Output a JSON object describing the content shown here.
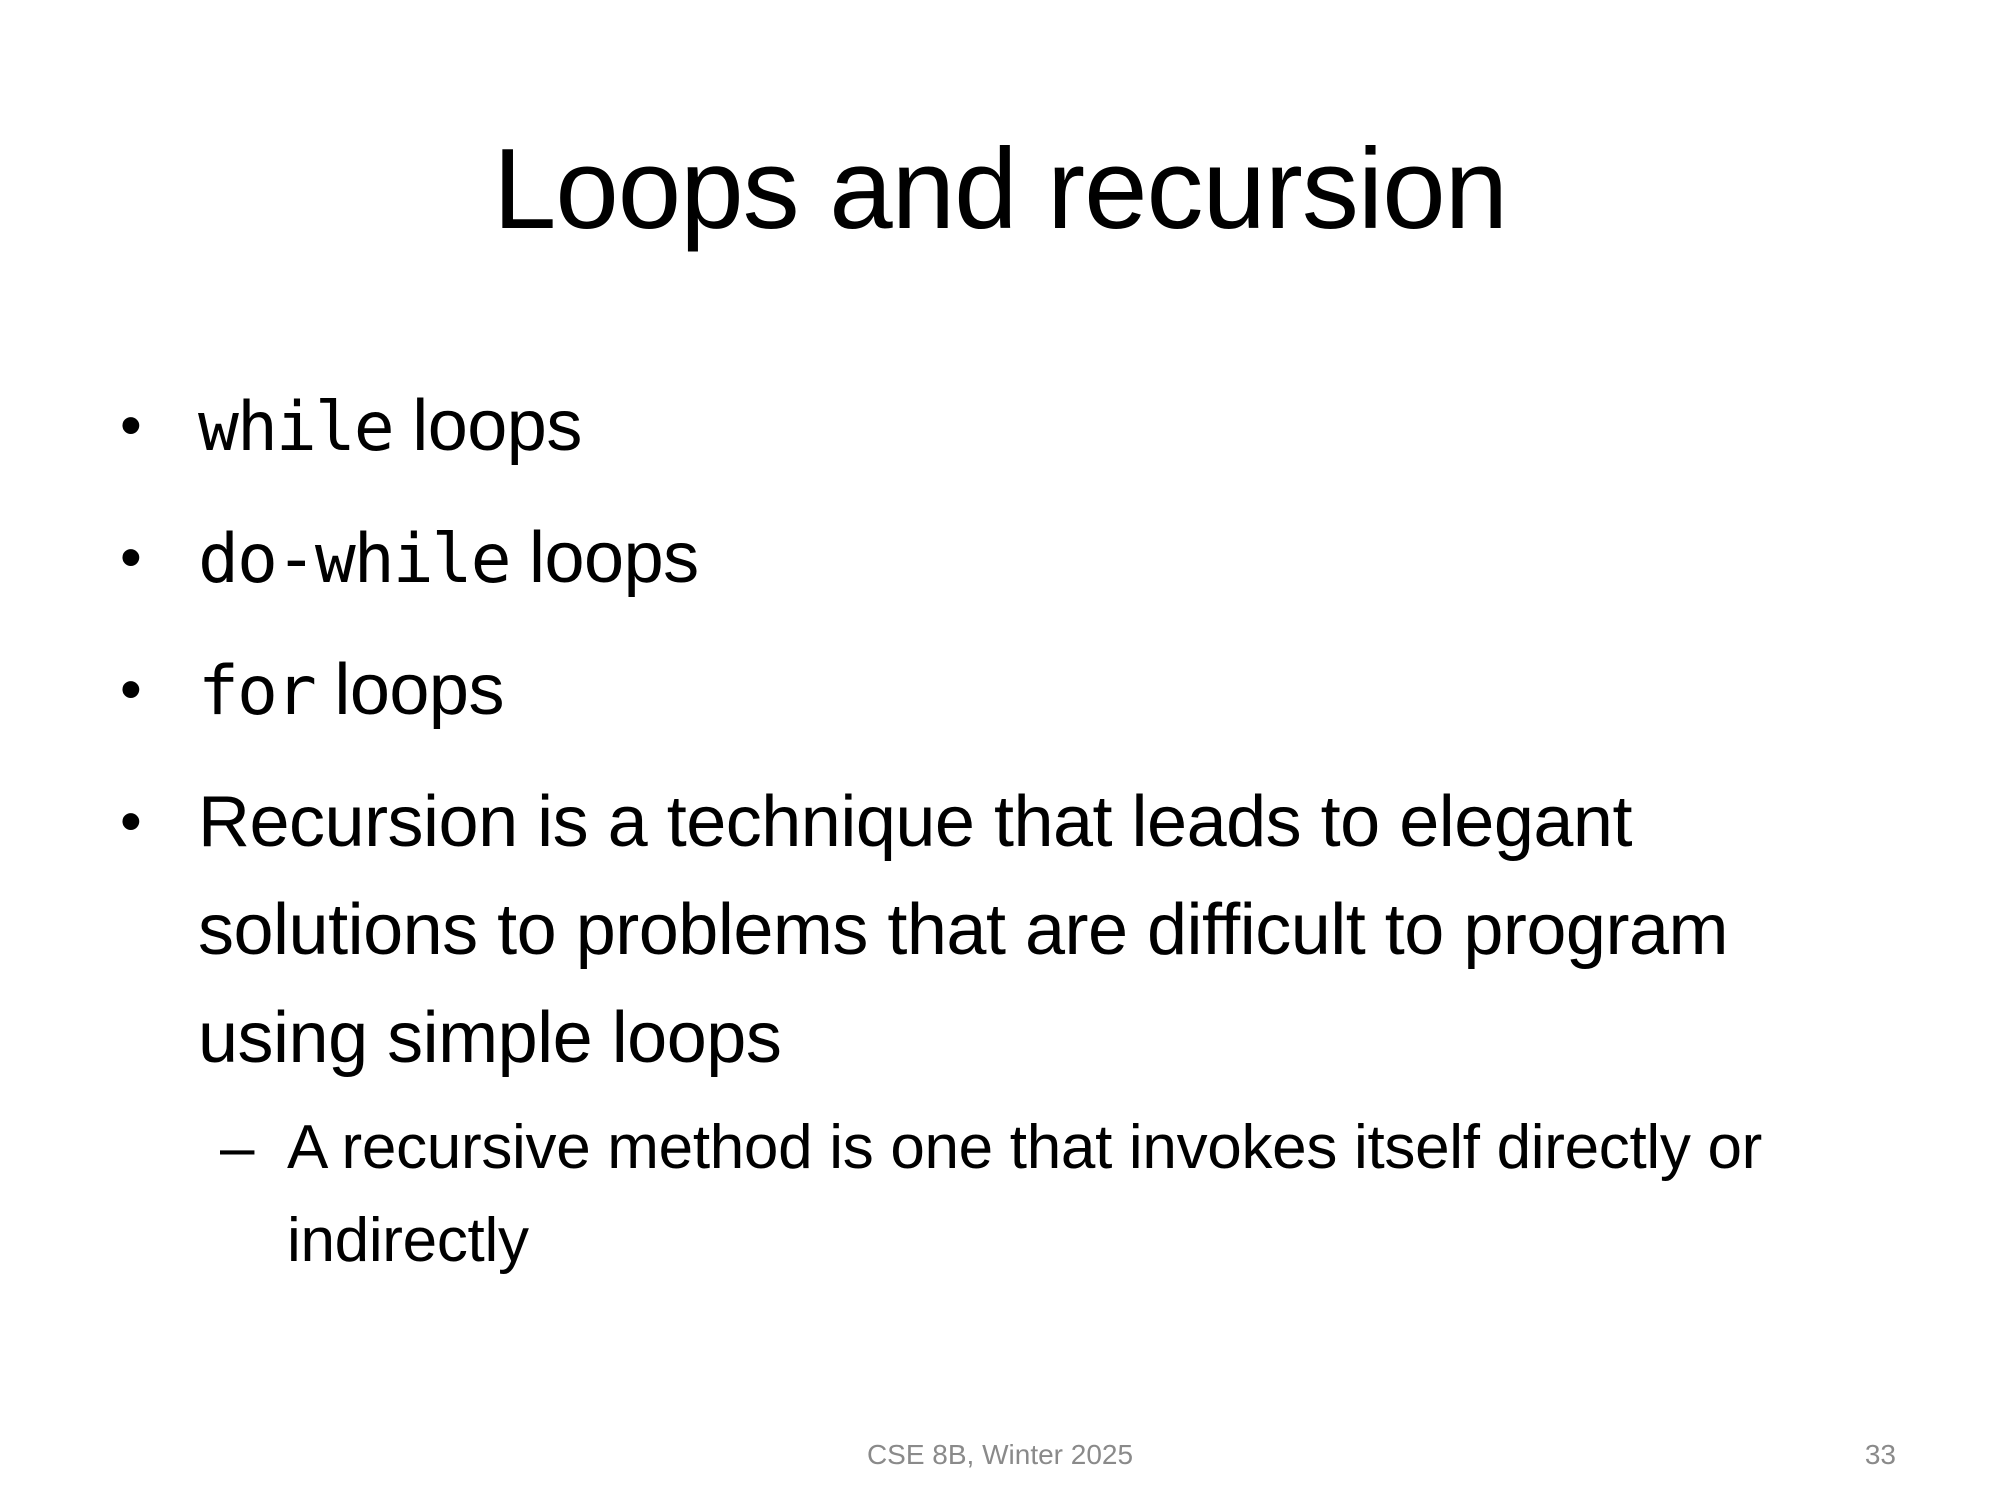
{
  "slide": {
    "title": "Loops and recursion",
    "bullets": [
      {
        "code": "while",
        "text": " loops"
      },
      {
        "code": "do-while",
        "text": " loops"
      },
      {
        "code": "for",
        "text": " loops"
      },
      {
        "text": "Recursion is a technique that leads to elegant solutions to problems that are difficult to program using simple loops"
      }
    ],
    "sub_bullets": [
      {
        "text": "A recursive method is one that invokes itself directly or indirectly"
      }
    ],
    "bullet_glyph": "•",
    "sub_bullet_glyph": "–"
  },
  "footer": {
    "course": "CSE 8B, Winter 2025",
    "page_number": "33"
  }
}
